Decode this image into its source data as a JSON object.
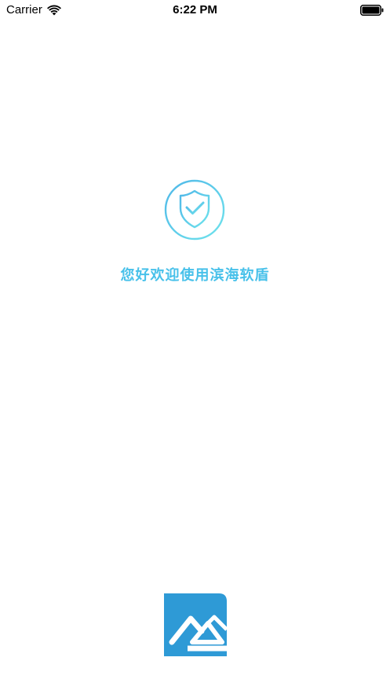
{
  "status_bar": {
    "carrier": "Carrier",
    "time": "6:22 PM",
    "icons": [
      "wifi-icon",
      "battery-icon"
    ]
  },
  "splash": {
    "badge_icon": "shield-check-icon",
    "welcome_text": "您好欢迎使用滨海软盾",
    "logo_icon": "brand-logo"
  },
  "colors": {
    "accent_start": "#4fb7e8",
    "accent_end": "#6fe3ec",
    "logo_blue": "#2e9ad6",
    "background": "#ffffff"
  }
}
